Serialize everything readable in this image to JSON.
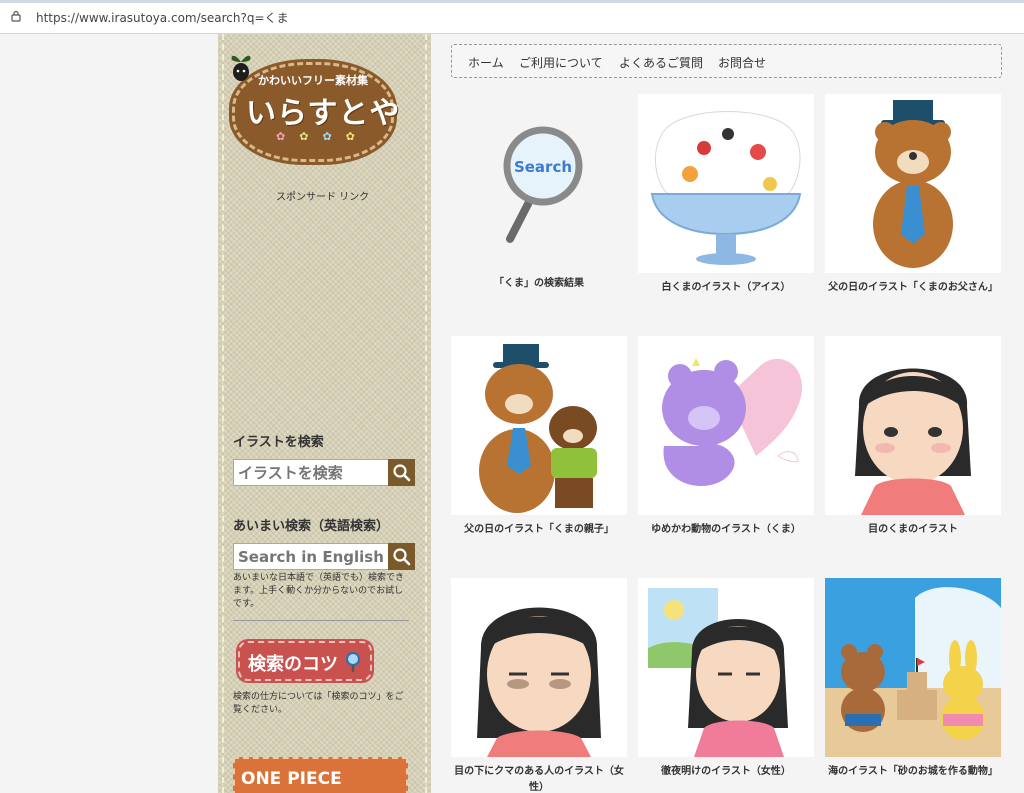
{
  "browser": {
    "url": "https://www.irasutoya.com/search?q=くま"
  },
  "logo": {
    "subtitle": "かわいいフリー素材集",
    "title": "いらすとや",
    "flowers": "✿✿✿✿"
  },
  "sidebar": {
    "sponsor": "スポンサード リンク",
    "search_heading": "イラストを検索",
    "search_placeholder": "イラストを検索",
    "fuzzy_heading": "あいまい検索（英語検索）",
    "english_placeholder": "Search in English",
    "fuzzy_note": "あいまいな日本語で（英語でも）検索できます。上手く動くか分からないのでお試しです。",
    "tips_label": "検索のコツ",
    "tips_note": "検索の仕方については「検索のコツ」をご覧ください。",
    "banner_label": "ONE PIECE"
  },
  "nav": {
    "items": [
      "ホーム",
      "ご利用について",
      "よくあるご質問",
      "お問合せ"
    ]
  },
  "results": {
    "search_card": {
      "icon_text": "Search",
      "caption": "「くま」の検索結果"
    },
    "items": [
      {
        "caption": "白くまのイラスト（アイス）",
        "icon": "shaved-ice-polar-bear"
      },
      {
        "caption": "父の日のイラスト「くまのお父さん」",
        "icon": "bear-father-hat"
      },
      {
        "caption": "父の日のイラスト「くまの親子」",
        "icon": "bear-parent-child"
      },
      {
        "caption": "ゆめかわ動物のイラスト（くま）",
        "icon": "purple-dreamy-bear"
      },
      {
        "caption": "目のくまのイラスト",
        "icon": "woman-dark-circles"
      },
      {
        "caption": "目の下にクマのある人のイラスト（女性）",
        "icon": "woman-tired-eyes"
      },
      {
        "caption": "徹夜明けのイラスト（女性）",
        "icon": "woman-all-nighter"
      },
      {
        "caption": "海のイラスト「砂のお城を作る動物」",
        "icon": "sandcastle-animals"
      }
    ]
  },
  "colors": {
    "sidebar_bg": "#d8d2b6",
    "logo_brown": "#8a5a2a",
    "search_btn": "#7a5a2a",
    "tips_red": "#c9524f"
  }
}
